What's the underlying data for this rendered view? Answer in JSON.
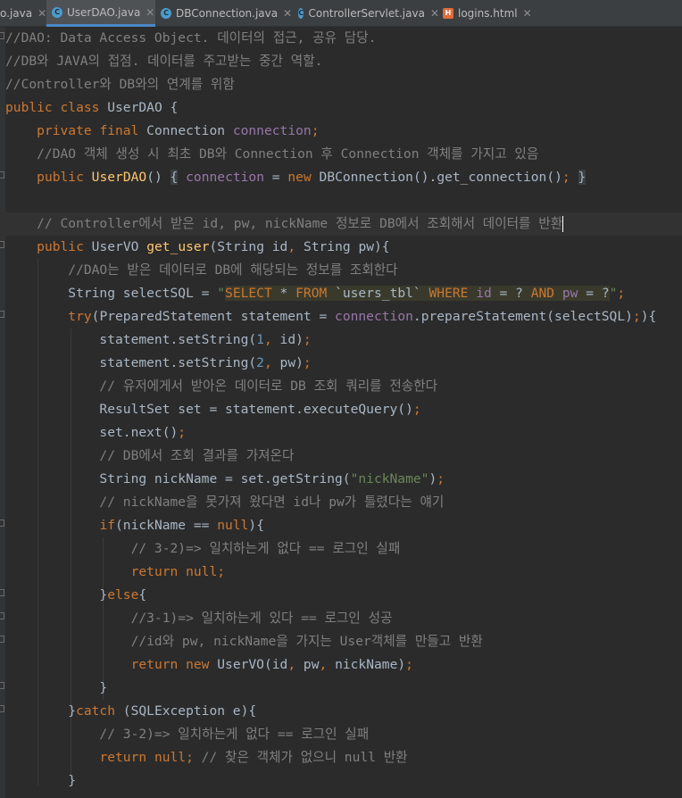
{
  "tabs": [
    {
      "label": "o.java"
    },
    {
      "label": "UserDAO.java"
    },
    {
      "label": "DBConnection.java"
    },
    {
      "label": "ControllerServlet.java"
    },
    {
      "label": "logins.html"
    }
  ],
  "close_glyph": "✕",
  "lines": [
    {
      "text": "//DAO: Data Access Object. 데이터의 접근, 공유 담당."
    },
    {
      "text": "//DB와 JAVA의 접점. 데이터를 주고받는 중간 역할."
    },
    {
      "text": "//Controller와 DB와의 연계를 위함"
    },
    {
      "text": "public class UserDAO {"
    },
    {
      "text": "    private final Connection connection;"
    },
    {
      "text": "    //DAO 객체 생성 시 최초 DB와 Connection 후 Connection 객체를 가지고 있음"
    },
    {
      "text": "    public UserDAO() { connection = new DBConnection().get_connection(); }"
    },
    {
      "text": ""
    },
    {
      "text": "    // Controller에서 받은 id, pw, nickName 정보로 DB에서 조회해서 데이터를 반환"
    },
    {
      "text": "    public UserVO get_user(String id, String pw){"
    },
    {
      "text": "        //DAO는 받은 데이터로 DB에 해당되는 정보를 조회한다"
    },
    {
      "text": "        String selectSQL = \"SELECT * FROM `users_tbl` WHERE id = ? AND pw = ?\";"
    },
    {
      "text": "        try(PreparedStatement statement = connection.prepareStatement(selectSQL);){"
    },
    {
      "text": "            statement.setString(1, id);"
    },
    {
      "text": "            statement.setString(2, pw);"
    },
    {
      "text": "            // 유저에게서 받아온 데이터로 DB 조회 쿼리를 전송한다"
    },
    {
      "text": "            ResultSet set = statement.executeQuery();"
    },
    {
      "text": "            set.next();"
    },
    {
      "text": "            // DB에서 조회 결과를 가져온다"
    },
    {
      "text": "            String nickName = set.getString(\"nickName\");"
    },
    {
      "text": "            // nickName을 못가져 왔다면 id나 pw가 틀렸다는 얘기"
    },
    {
      "text": "            if(nickName == null){"
    },
    {
      "text": "                // 3-2)=> 일치하는게 없다 == 로그인 실패"
    },
    {
      "text": "                return null;"
    },
    {
      "text": "            }else{"
    },
    {
      "text": "                //3-1)=> 일치하는게 있다 == 로그인 성공"
    },
    {
      "text": "                //id와 pw, nickName을 가지는 User객체를 만들고 반환"
    },
    {
      "text": "                return new UserVO(id, pw, nickName);"
    },
    {
      "text": "            }"
    },
    {
      "text": "        }catch (SQLException e){"
    },
    {
      "text": "            // 3-2)=> 일치하는게 없다 == 로그인 실패"
    },
    {
      "text": "            return null; // 찾은 객체가 없으니 null 반환"
    },
    {
      "text": "        }"
    },
    {
      "text": "    }"
    }
  ],
  "colors": {
    "background": "#2b2b2b",
    "keyword": "#cc7832",
    "comment": "#808080",
    "method": "#ffc66d",
    "field": "#9876aa",
    "string": "#6a8759",
    "number": "#6897bb",
    "text": "#a9b7c6",
    "tab_underline": "#4a88c7"
  }
}
